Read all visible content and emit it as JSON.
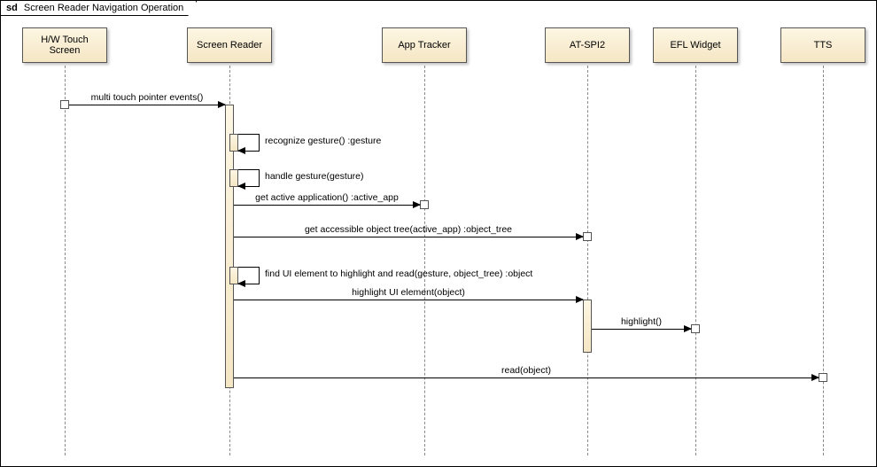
{
  "chart_data": {
    "type": "sequence_diagram",
    "title": "Screen Reader Navigation Operation",
    "lifelines": [
      "H/W Touch Screen",
      "Screen Reader",
      "App Tracker",
      "AT-SPI2",
      "EFL Widget",
      "TTS"
    ],
    "messages": [
      {
        "from": "H/W Touch Screen",
        "to": "Screen Reader",
        "label": "multi touch pointer events()",
        "type": "async"
      },
      {
        "from": "Screen Reader",
        "to": "Screen Reader",
        "label": "recognize gesture() :gesture",
        "type": "self"
      },
      {
        "from": "Screen Reader",
        "to": "Screen Reader",
        "label": "handle gesture(gesture)",
        "type": "self"
      },
      {
        "from": "Screen Reader",
        "to": "App Tracker",
        "label": "get active application() :active_app",
        "type": "sync"
      },
      {
        "from": "Screen Reader",
        "to": "AT-SPI2",
        "label": "get accessible object tree(active_app) :object_tree",
        "type": "sync"
      },
      {
        "from": "Screen Reader",
        "to": "Screen Reader",
        "label": "find UI element to highlight and read(gesture, object_tree) :object",
        "type": "self"
      },
      {
        "from": "Screen Reader",
        "to": "AT-SPI2",
        "label": "highlight UI element(object)",
        "type": "sync"
      },
      {
        "from": "AT-SPI2",
        "to": "EFL Widget",
        "label": "highlight()",
        "type": "sync"
      },
      {
        "from": "Screen Reader",
        "to": "TTS",
        "label": "read(object)",
        "type": "sync"
      }
    ]
  },
  "frame": {
    "prefix": "sd",
    "title": "Screen Reader Navigation Operation"
  },
  "lifelines": {
    "hw": {
      "label": "H/W Touch Screen"
    },
    "sr": {
      "label": "Screen Reader"
    },
    "app": {
      "label": "App Tracker"
    },
    "atspi": {
      "label": "AT-SPI2"
    },
    "efl": {
      "label": "EFL Widget"
    },
    "tts": {
      "label": "TTS"
    }
  },
  "messages": {
    "m1": "multi touch pointer events()",
    "m2": "recognize gesture() :gesture",
    "m3": "handle gesture(gesture)",
    "m4": "get active application() :active_app",
    "m5": "get accessible object tree(active_app) :object_tree",
    "m6": "find UI element to highlight and read(gesture, object_tree) :object",
    "m7": "highlight UI element(object)",
    "m8": "highlight()",
    "m9": "read(object)"
  }
}
